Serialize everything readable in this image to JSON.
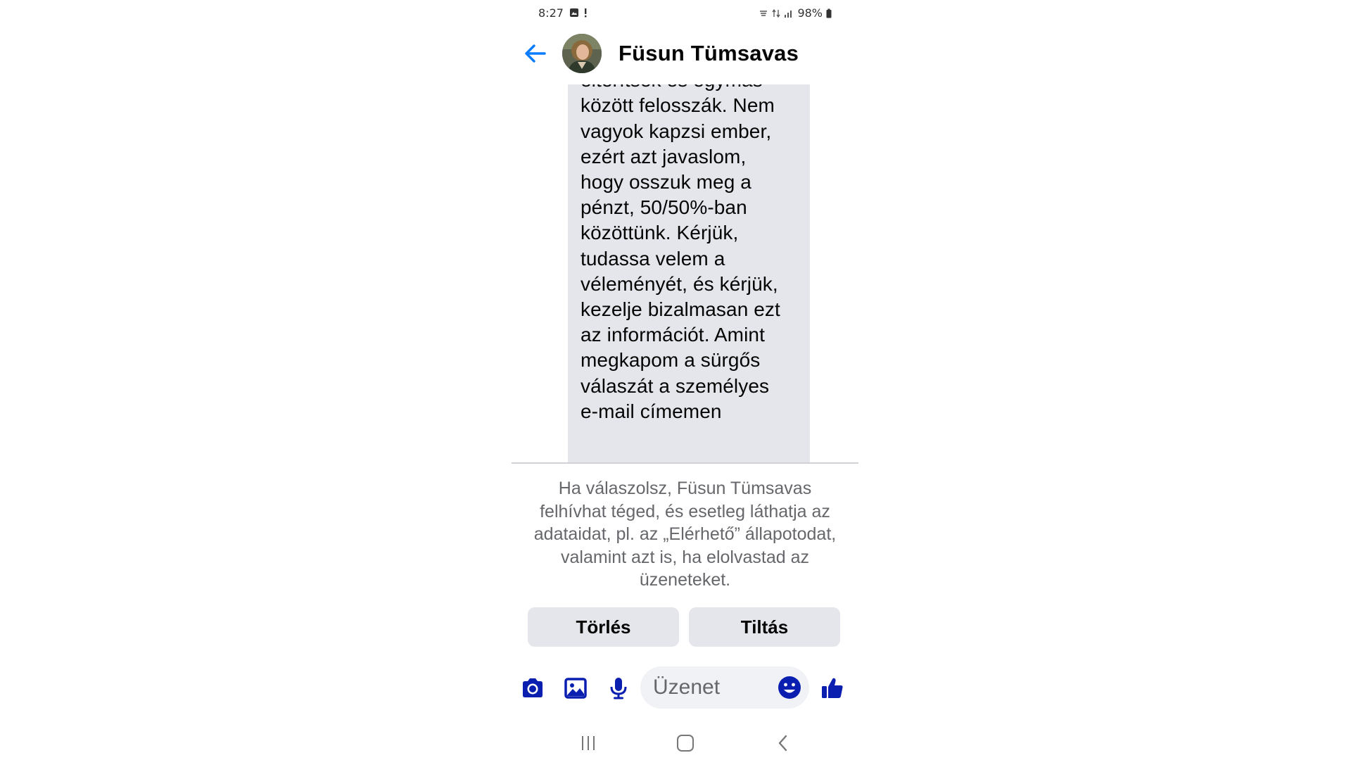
{
  "status_bar": {
    "time": "8:27",
    "battery": "98%"
  },
  "header": {
    "contact_name": "Füsun Tümsavas"
  },
  "message": {
    "text": "bankigazgatók\neltérítsék és egymás\nközött felosszák. Nem\nvagyok kapzsi ember,\nezért azt javaslom,\nhogy osszuk meg a\npénzt, 50/50%-ban\nközöttünk. Kérjük,\ntudassa velem a\nvéleményét, és kérjük,\nkezelje bizalmasan ezt\naz információt. Amint\nmegkapom a sürgős\nválaszát a személyes\ne-mail címemen"
  },
  "request_panel": {
    "notice": "Ha válaszolsz, Füsun Tümsavas felhívhat téged, és esetleg láthatja az adataidat, pl. az „Elérhető” állapotodat, valamint azt is, ha elolvastad az üzeneteket.",
    "delete_label": "Törlés",
    "block_label": "Tiltás"
  },
  "composer": {
    "placeholder": "Üzenet"
  },
  "colors": {
    "accent": "#0a7cff",
    "composer_icon": "#0a1fb0",
    "bubble": "#e4e6eb",
    "button": "#e4e6eb",
    "secondary_text": "#65676b"
  },
  "icons": {
    "back": "arrow-left-icon",
    "camera": "camera-icon",
    "gallery": "image-icon",
    "mic": "microphone-icon",
    "emoji": "smiley-icon",
    "like": "thumbs-up-icon",
    "recents": "recents-icon",
    "home": "home-icon",
    "nav_back": "chevron-left-icon"
  }
}
